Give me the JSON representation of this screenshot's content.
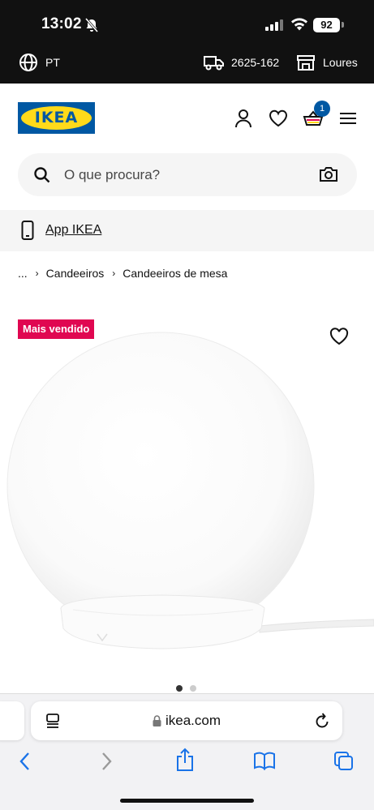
{
  "status_bar": {
    "time": "13:02",
    "battery": "92"
  },
  "info_bar": {
    "language": "PT",
    "postal_code": "2625-162",
    "store": "Loures"
  },
  "header": {
    "logo_text": "IKEA",
    "cart_count": "1"
  },
  "search": {
    "placeholder": "O que procura?"
  },
  "app_banner": {
    "label": "App IKEA"
  },
  "breadcrumb": {
    "items": [
      "...",
      "Candeeiros",
      "Candeeiros de mesa"
    ]
  },
  "product": {
    "badge": "Mais vendido"
  },
  "browser": {
    "url": "ikea.com"
  },
  "colors": {
    "brand_blue": "#0058a3",
    "brand_yellow": "#ffda1a",
    "badge_red": "#e00751"
  }
}
